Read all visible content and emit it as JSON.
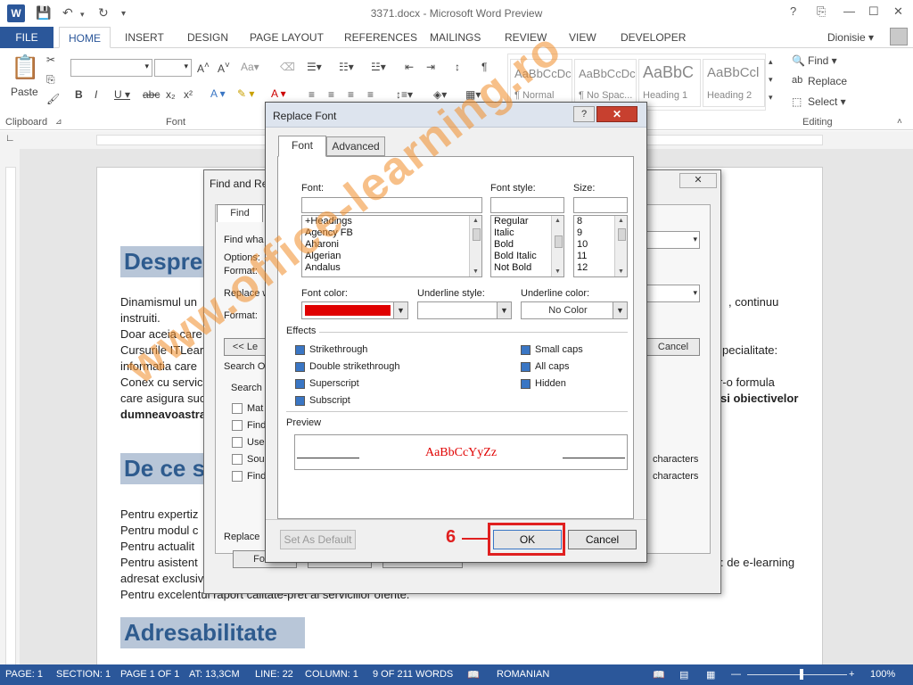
{
  "window": {
    "title": "3371.docx - Microsoft Word Preview",
    "app_icon": "W",
    "controls": [
      "?",
      "⎘",
      "—",
      "☐",
      "✕"
    ]
  },
  "ribbon": {
    "file_tab": "FILE",
    "tabs": [
      "HOME",
      "INSERT",
      "DESIGN",
      "PAGE LAYOUT",
      "REFERENCES",
      "MAILINGS",
      "REVIEW",
      "VIEW",
      "DEVELOPER"
    ],
    "user": "Dionisie ▾",
    "clipboard": {
      "label": "Clipboard",
      "paste": "Paste"
    },
    "font": {
      "label": "Font"
    },
    "styles": [
      {
        "sample": "AaBbCcDc",
        "name": "¶ Normal"
      },
      {
        "sample": "AaBbCcDc",
        "name": "¶ No Spac..."
      },
      {
        "sample": "AaBbC",
        "name": "Heading 1"
      },
      {
        "sample": "AaBbCcl",
        "name": "Heading 2"
      }
    ],
    "editing": {
      "label": "Editing",
      "find": "Find ▾",
      "replace": "Replace",
      "select": "Select ▾"
    }
  },
  "document": {
    "heading1": "Despre",
    "heading2": "De ce s",
    "heading3": "Adresabilitate",
    "lines": [
      "Dinamismul un",
      "instruiti.",
      "Doar aceia care",
      "Cursurile ITLear",
      "informatia care",
      "Conex cu servic",
      "care asigura suc",
      "dumneavoastra",
      "Pentru expertiz",
      "Pentru modul c",
      "Pentru actualit",
      "Pentru asistent",
      "adresat exclusiv",
      "Pentru excelentul raport calitate-pret al serviciilor oferite."
    ],
    "right_fragments": [
      ", continuu",
      "pecialitate:",
      "r-o formula",
      "si obiectivelor",
      ": de e-learning"
    ]
  },
  "find_replace": {
    "title": "Find and Re",
    "tab_find": "Find",
    "find_what": "Find wha",
    "options": "Options:",
    "format": "Format:",
    "replace_with": "Replace w",
    "format2": "Format:",
    "less_button": "<< Le",
    "cancel": "Cancel",
    "search_options": "Search O",
    "search": "Search",
    "checks": [
      "Mat",
      "Find",
      "Use",
      "Sou",
      "Find"
    ],
    "right_checks": [
      "characters",
      "characters"
    ],
    "replace_section": "Replace",
    "format_button": "Form"
  },
  "replace_font": {
    "title": "Replace Font",
    "help": "?",
    "close": "✕",
    "tabs": [
      "Font",
      "Advanced"
    ],
    "font_label": "Font:",
    "font_style_label": "Font style:",
    "size_label": "Size:",
    "fonts": [
      "+Headings",
      "Agency FB",
      "Aharoni",
      "Algerian",
      "Andalus"
    ],
    "styles": [
      "Regular",
      "Italic",
      "Bold",
      "Bold Italic",
      "Not Bold"
    ],
    "sizes": [
      "8",
      "9",
      "10",
      "11",
      "12"
    ],
    "font_color_label": "Font color:",
    "font_color": "#e00000",
    "underline_style_label": "Underline style:",
    "underline_color_label": "Underline color:",
    "underline_color_value": "No Color",
    "effects_label": "Effects",
    "effects_left": [
      "Strikethrough",
      "Double strikethrough",
      "Superscript",
      "Subscript"
    ],
    "effects_right": [
      "Small caps",
      "All caps",
      "Hidden"
    ],
    "preview_label": "Preview",
    "preview_text": "AaBbCcYyZz",
    "set_default": "Set As Default",
    "ok": "OK",
    "cancel": "Cancel"
  },
  "callout": {
    "step": "6"
  },
  "watermark": "www.office-learning.ro",
  "status": {
    "page": "PAGE: 1",
    "section": "SECTION: 1",
    "page_of": "PAGE 1 OF 1",
    "at": "AT: 13,3CM",
    "line": "LINE: 22",
    "column": "COLUMN: 1",
    "words": "9 OF 211 WORDS",
    "language": "ROMANIAN",
    "zoom": "100%"
  },
  "colors": {
    "accent": "#2b579a",
    "callout": "#e02020",
    "heading_bg": "#b8c6d8"
  }
}
